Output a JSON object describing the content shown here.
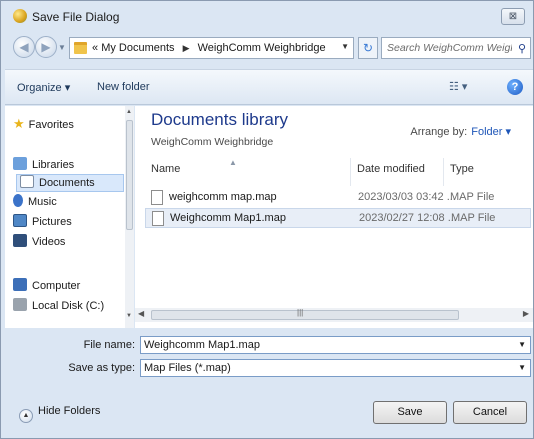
{
  "window": {
    "title": "Save File Dialog",
    "close_glyph": "⊠"
  },
  "address": {
    "crumbs": [
      "«",
      "My Documents",
      "WeighComm Weighbridge"
    ],
    "search_placeholder": "Search WeighComm Weighbri..."
  },
  "toolbar": {
    "organize": "Organize ▾",
    "new_folder": "New folder",
    "help": "?"
  },
  "nav": {
    "favorites": "Favorites",
    "libraries": "Libraries",
    "documents": "Documents",
    "music": "Music",
    "pictures": "Pictures",
    "videos": "Videos",
    "computer": "Computer",
    "local_disk": "Local Disk (C:)"
  },
  "library": {
    "title": "Documents library",
    "subtitle": "WeighComm Weighbridge",
    "arrange_label": "Arrange by:",
    "arrange_value": "Folder ▾"
  },
  "columns": {
    "name": "Name",
    "date": "Date modified",
    "type": "Type"
  },
  "files": [
    {
      "name": "weighcomm map.map",
      "date": "2023/03/03 03:42 ...",
      "type": "MAP File"
    },
    {
      "name": "Weighcomm Map1.map",
      "date": "2023/02/27 12:08 ...",
      "type": "MAP File"
    }
  ],
  "form": {
    "filename_label": "File name:",
    "filename_value": "Weighcomm Map1.map",
    "savetype_label": "Save as type:",
    "savetype_value": "Map Files (*.map)"
  },
  "footer": {
    "hide_folders": "Hide Folders",
    "save": "Save",
    "cancel": "Cancel"
  },
  "colors": {
    "accent": "#1e3a8c",
    "chrome": "#dbe6f3",
    "selection": "#d9e8fb"
  }
}
